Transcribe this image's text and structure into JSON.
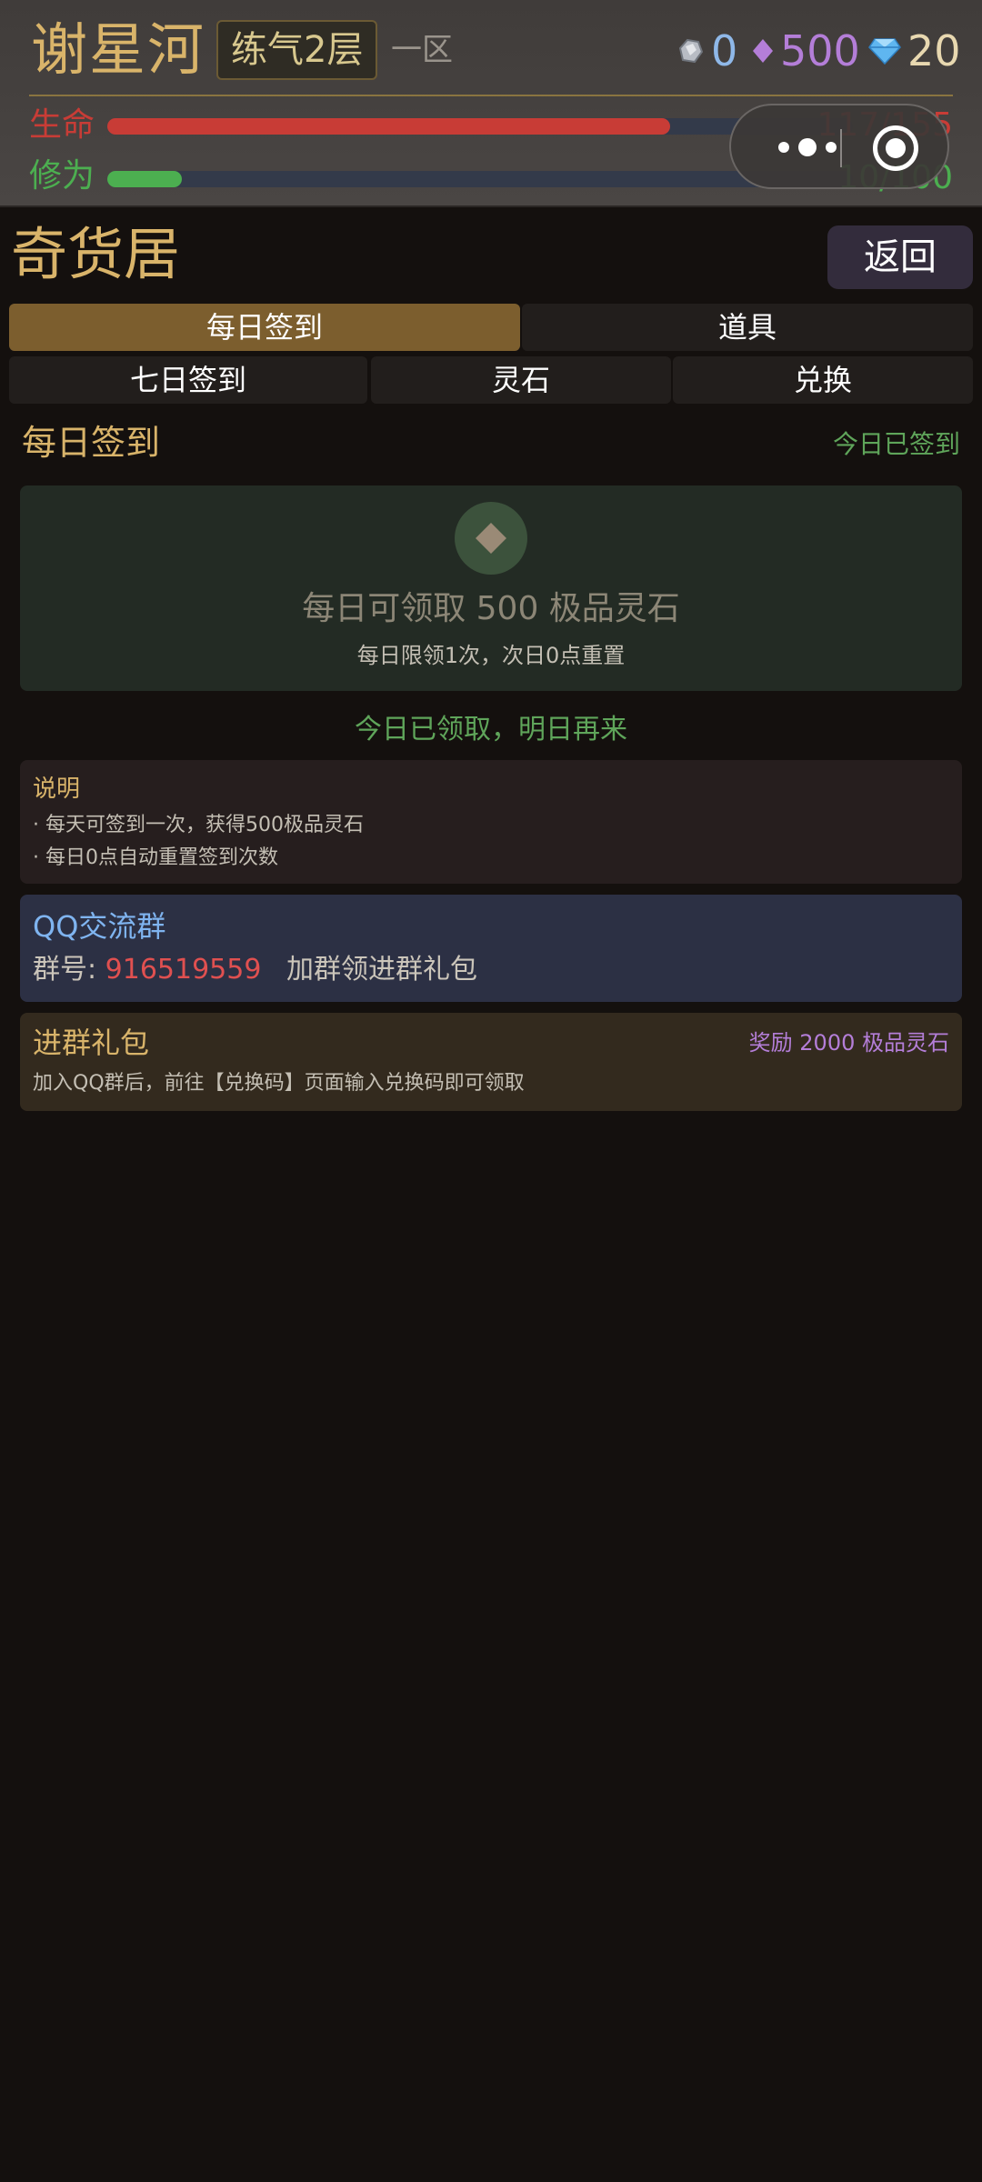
{
  "header": {
    "player_name": "谢星河",
    "realm": "练气2层",
    "zone": "一区",
    "currencies": [
      {
        "name": "silver",
        "value": "0",
        "color": "#8fb8e8"
      },
      {
        "name": "spirit-stone",
        "value": "500",
        "color": "#b47ed8"
      },
      {
        "name": "diamond",
        "value": "20",
        "color": "#e8d8b0"
      }
    ],
    "hp": {
      "label": "生命",
      "value": "117/155",
      "current": 117,
      "max": 155,
      "color": "#c83c36"
    },
    "cultivation": {
      "label": "修为",
      "value": "10/100",
      "current": 10,
      "max": 100,
      "color": "#4caf50"
    }
  },
  "page": {
    "title": "奇货居",
    "back_label": "返回"
  },
  "tabs_primary": [
    {
      "label": "每日签到",
      "active": true
    },
    {
      "label": "道具",
      "active": false
    }
  ],
  "tabs_secondary": [
    {
      "label": "七日签到"
    },
    {
      "label": "灵石"
    },
    {
      "label": "兑换"
    }
  ],
  "daily": {
    "title": "每日签到",
    "status": "今日已签到",
    "card_main": "每日可领取 500 极品灵石",
    "card_sub": "每日限领1次，次日0点重置",
    "claimed_text": "今日已领取，明日再来"
  },
  "info": {
    "title": "说明",
    "lines": [
      "·  每天可签到一次，获得500极品灵石",
      "·  每日0点自动重置签到次数"
    ]
  },
  "qq": {
    "title": "QQ交流群",
    "prefix": "群号:",
    "number": "916519559",
    "suffix": "加群领进群礼包"
  },
  "gift": {
    "title": "进群礼包",
    "reward": "奖励 2000 极品灵石",
    "desc": "加入QQ群后，前往【兑换码】页面输入兑换码即可领取"
  }
}
